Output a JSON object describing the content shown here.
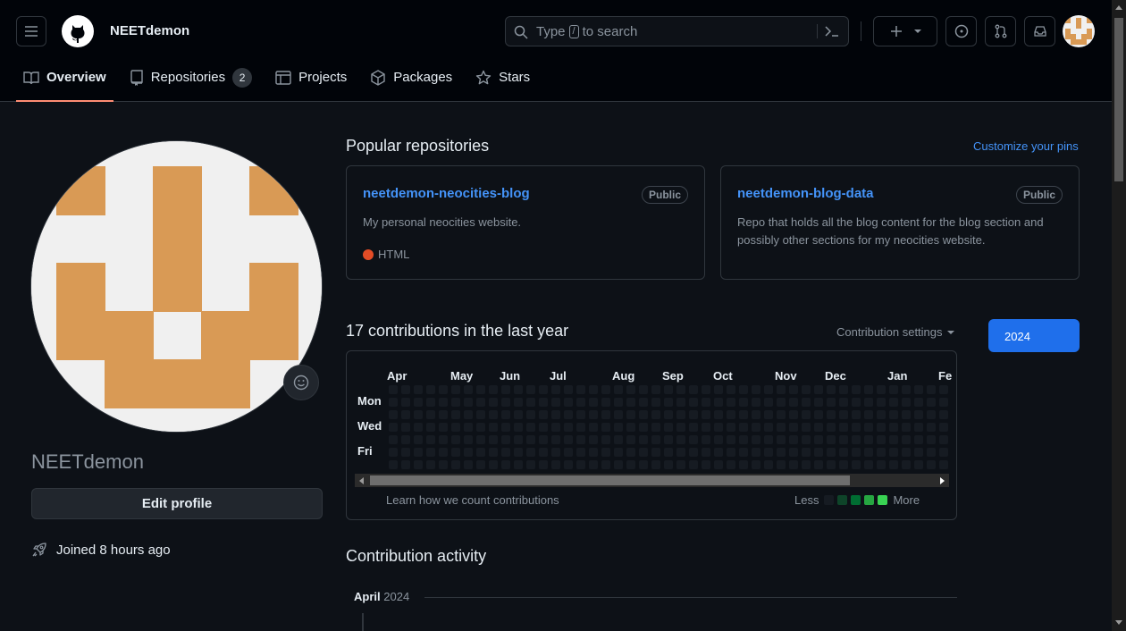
{
  "header": {
    "context_name": "NEETdemon",
    "search_placeholder_pre": "Type",
    "search_key": "/",
    "search_placeholder_post": "to search"
  },
  "nav": {
    "tabs": [
      {
        "label": "Overview",
        "icon": "book-icon",
        "active": true
      },
      {
        "label": "Repositories",
        "icon": "repo-icon",
        "counter": "2"
      },
      {
        "label": "Projects",
        "icon": "table-icon"
      },
      {
        "label": "Packages",
        "icon": "package-icon"
      },
      {
        "label": "Stars",
        "icon": "star-icon"
      }
    ]
  },
  "profile": {
    "username": "NEETdemon",
    "edit_label": "Edit profile",
    "joined": "Joined 8 hours ago",
    "avatar_color": "#d99a55"
  },
  "popular": {
    "title": "Popular repositories",
    "customize": "Customize your pins",
    "repos": [
      {
        "name": "neetdemon-neocities-blog",
        "visibility": "Public",
        "description": "My personal neocities website.",
        "language": "HTML",
        "language_color": "#e34c26"
      },
      {
        "name": "neetdemon-blog-data",
        "visibility": "Public",
        "description": "Repo that holds all the blog content for the blog section and possibly other sections for my neocities website."
      }
    ]
  },
  "contrib": {
    "title": "17 contributions in the last year",
    "settings": "Contribution settings",
    "year": "2024",
    "months": [
      "Apr",
      "May",
      "Jun",
      "Jul",
      "Aug",
      "Sep",
      "Oct",
      "Nov",
      "Dec",
      "Jan",
      "Fe"
    ],
    "days": [
      "Mon",
      "Wed",
      "Fri"
    ],
    "learn": "Learn how we count contributions",
    "less": "Less",
    "more": "More",
    "legend_colors": [
      "#161b22",
      "#0e4429",
      "#006d32",
      "#26a641",
      "#39d353"
    ]
  },
  "activity": {
    "title": "Contribution activity",
    "month": "April",
    "year": "2024"
  }
}
